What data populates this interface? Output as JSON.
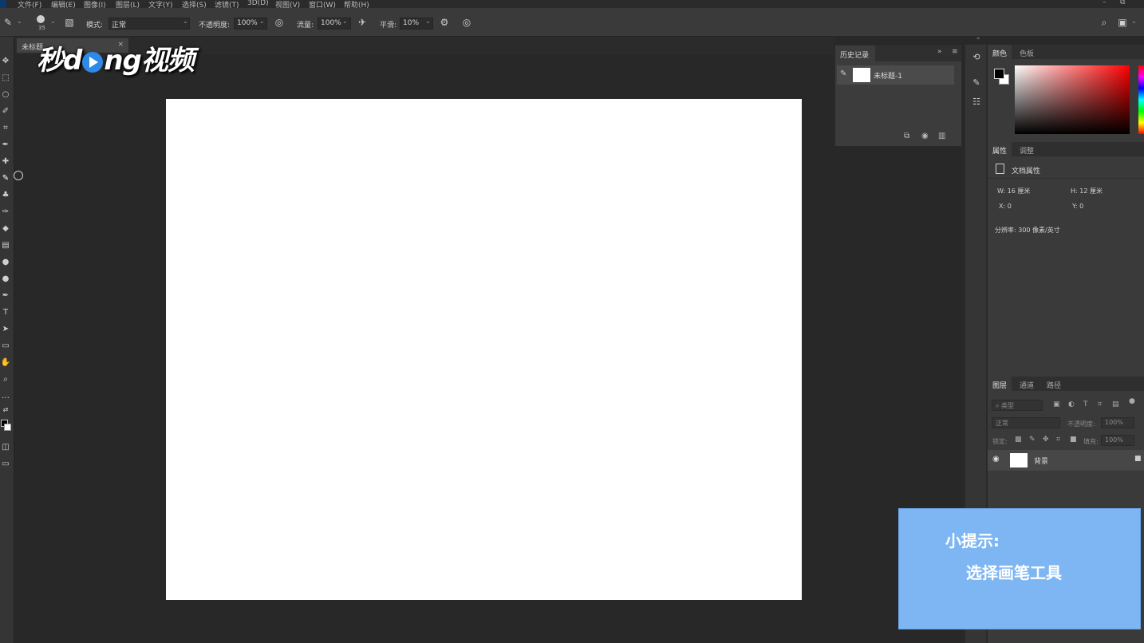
{
  "menubar": {
    "items": [
      "文件(F)",
      "编辑(E)",
      "图像(I)",
      "图层(L)",
      "文字(Y)",
      "选择(S)",
      "滤镜(T)",
      "3D(D)",
      "视图(V)",
      "窗口(W)",
      "帮助(H)"
    ]
  },
  "options": {
    "brush_size": "35",
    "mode_label": "模式:",
    "mode_value": "正常",
    "opacity_label": "不透明度:",
    "opacity_value": "100%",
    "flow_label": "流量:",
    "flow_value": "100%",
    "smoothing_label": "平滑:",
    "smoothing_value": "10%"
  },
  "document": {
    "tab_title": "未标题",
    "tab_close": "×"
  },
  "watermark": {
    "part1": "秒d",
    "part2": "ng视频"
  },
  "history": {
    "tab_label": "历史记录",
    "expand": "»",
    "menu": "≡",
    "item_label": "未标题-1"
  },
  "color_panel": {
    "tabs": [
      "颜色",
      "色板"
    ],
    "fg_color": "#000000",
    "bg_color": "#ffffff"
  },
  "properties": {
    "tabs": [
      "属性",
      "调整"
    ],
    "doc_label": "文档属性",
    "w": "W:  16 厘米",
    "h": "H:  12 厘米",
    "x": "X:  0",
    "y": "Y:  0",
    "resolution": "分辨率: 300 像素/英寸"
  },
  "layers": {
    "tabs": [
      "图层",
      "通道",
      "路径"
    ],
    "filter_placeholder": "类型",
    "blend_mode": "正常",
    "opacity_label": "不透明度:",
    "opacity_value": "100%",
    "lock_label": "锁定:",
    "fill_label": "填充:",
    "fill_value": "100%",
    "layer_name": "背景"
  },
  "tip": {
    "title": "小提示:",
    "body": "选择画笔工具"
  }
}
